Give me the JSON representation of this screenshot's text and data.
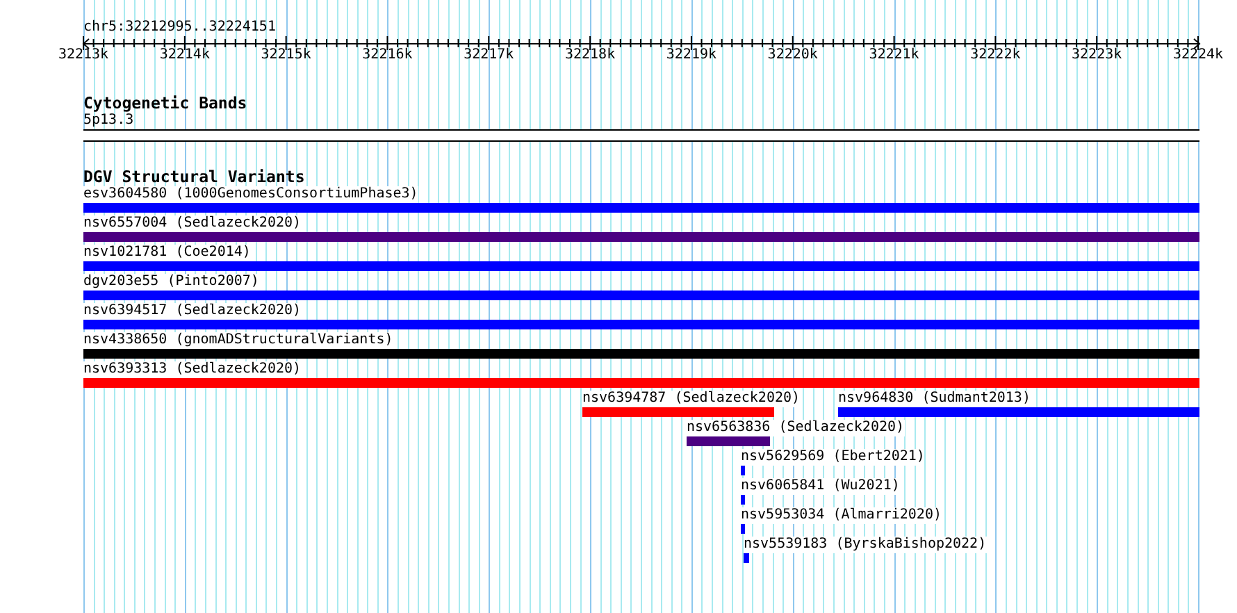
{
  "location": "chr5:32212995..32224151",
  "axis": {
    "ticks": [
      "32213k",
      "32214k",
      "32215k",
      "32216k",
      "32217k",
      "32218k",
      "32219k",
      "32220k",
      "32221k",
      "32222k",
      "32223k",
      "32224k"
    ]
  },
  "tracks": [
    {
      "kind": "band",
      "title": "Cytogenetic Bands",
      "features": [
        {
          "label": "5p13.3"
        }
      ]
    },
    {
      "kind": "variant",
      "title": "DGV Structural Variants",
      "features": [
        {
          "label": "esv3604580 (1000GenomesConsortiumPhase3)",
          "color": "#0000ff"
        },
        {
          "label": "nsv6557004 (Sedlazeck2020)",
          "color": "#4b0082"
        },
        {
          "label": "nsv1021781 (Coe2014)",
          "color": "#0000ff"
        },
        {
          "label": "dgv203e55 (Pinto2007)",
          "color": "#0000ff"
        },
        {
          "label": "nsv6394517 (Sedlazeck2020)",
          "color": "#0000ff"
        },
        {
          "label": "nsv4338650 (gnomADStructuralVariants)",
          "color": "#000000"
        },
        {
          "label": "nsv6393313 (Sedlazeck2020)",
          "color": "#ff0000"
        },
        {
          "label": "nsv6394787 (Sedlazeck2020)",
          "color": "#ff0000"
        },
        {
          "label": "nsv964830 (Sudmant2013)",
          "color": "#0000ff"
        },
        {
          "label": "nsv6563836 (Sedlazeck2020)",
          "color": "#4b0082"
        },
        {
          "label": "nsv5629569 (Ebert2021)",
          "color": "#0000ff"
        },
        {
          "label": "nsv6065841 (Wu2021)",
          "color": "#0000ff"
        },
        {
          "label": "nsv5953034 (Almarri2020)",
          "color": "#0000ff"
        },
        {
          "label": "nsv5539183 (ByrskaBishop2022)",
          "color": "#0000ff"
        }
      ]
    }
  ]
}
